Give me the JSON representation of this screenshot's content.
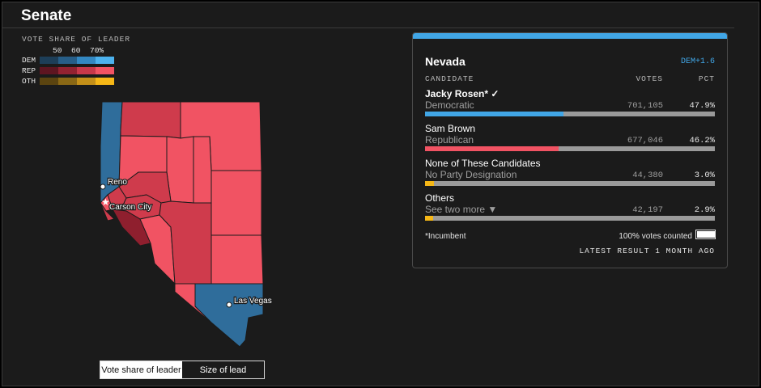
{
  "page": {
    "title": "Senate"
  },
  "legend": {
    "title": "VOTE SHARE OF LEADER",
    "ticks": [
      "50",
      "60",
      "70%"
    ],
    "rows": [
      {
        "label": "DEM",
        "colors": [
          "#1d3e58",
          "#275e88",
          "#3388c2",
          "#4cb2ee"
        ]
      },
      {
        "label": "REP",
        "colors": [
          "#5e1521",
          "#932231",
          "#c8384a",
          "#f15363"
        ]
      },
      {
        "label": "OTH",
        "colors": [
          "#5b4410",
          "#8a6815",
          "#c49019",
          "#f5b717"
        ]
      }
    ]
  },
  "map": {
    "cities": [
      "Reno",
      "Carson City",
      "Las Vegas"
    ],
    "colors": {
      "dem": "#2f6d9b",
      "rep_light": "#f15363",
      "rep_mid": "#cf3b4c",
      "rep_dark": "#8f1f2e"
    }
  },
  "toggle": {
    "options": [
      "Vote share of leader",
      "Size of lead"
    ],
    "selected": "Vote share of leader"
  },
  "race": {
    "state": "Nevada",
    "margin": "DEM+1.6",
    "accent": "#41a6e6",
    "headers": {
      "candidate": "CANDIDATE",
      "votes": "VOTES",
      "pct": "PCT"
    },
    "candidates": [
      {
        "name": "Jacky Rosen*",
        "winner_mark": "✓",
        "party": "Democratic",
        "votes": "701,105",
        "pct": "47.9%",
        "share": 0.479,
        "color": "#41a6e6"
      },
      {
        "name": "Sam Brown",
        "party": "Republican",
        "votes": "677,046",
        "pct": "46.2%",
        "share": 0.462,
        "color": "#f15363"
      },
      {
        "name": "None of These Candidates",
        "party": "No Party Designation",
        "votes": "44,380",
        "pct": "3.0%",
        "share": 0.03,
        "color": "#f5b717"
      },
      {
        "name": "Others",
        "party": "See two more ▼",
        "votes": "42,197",
        "pct": "2.9%",
        "share": 0.029,
        "color": "#f5b717"
      }
    ],
    "footnote": "*Incumbent",
    "counted": "100% votes counted",
    "counted_share": 1.0,
    "latest": "LATEST RESULT 1 MONTH AGO"
  }
}
